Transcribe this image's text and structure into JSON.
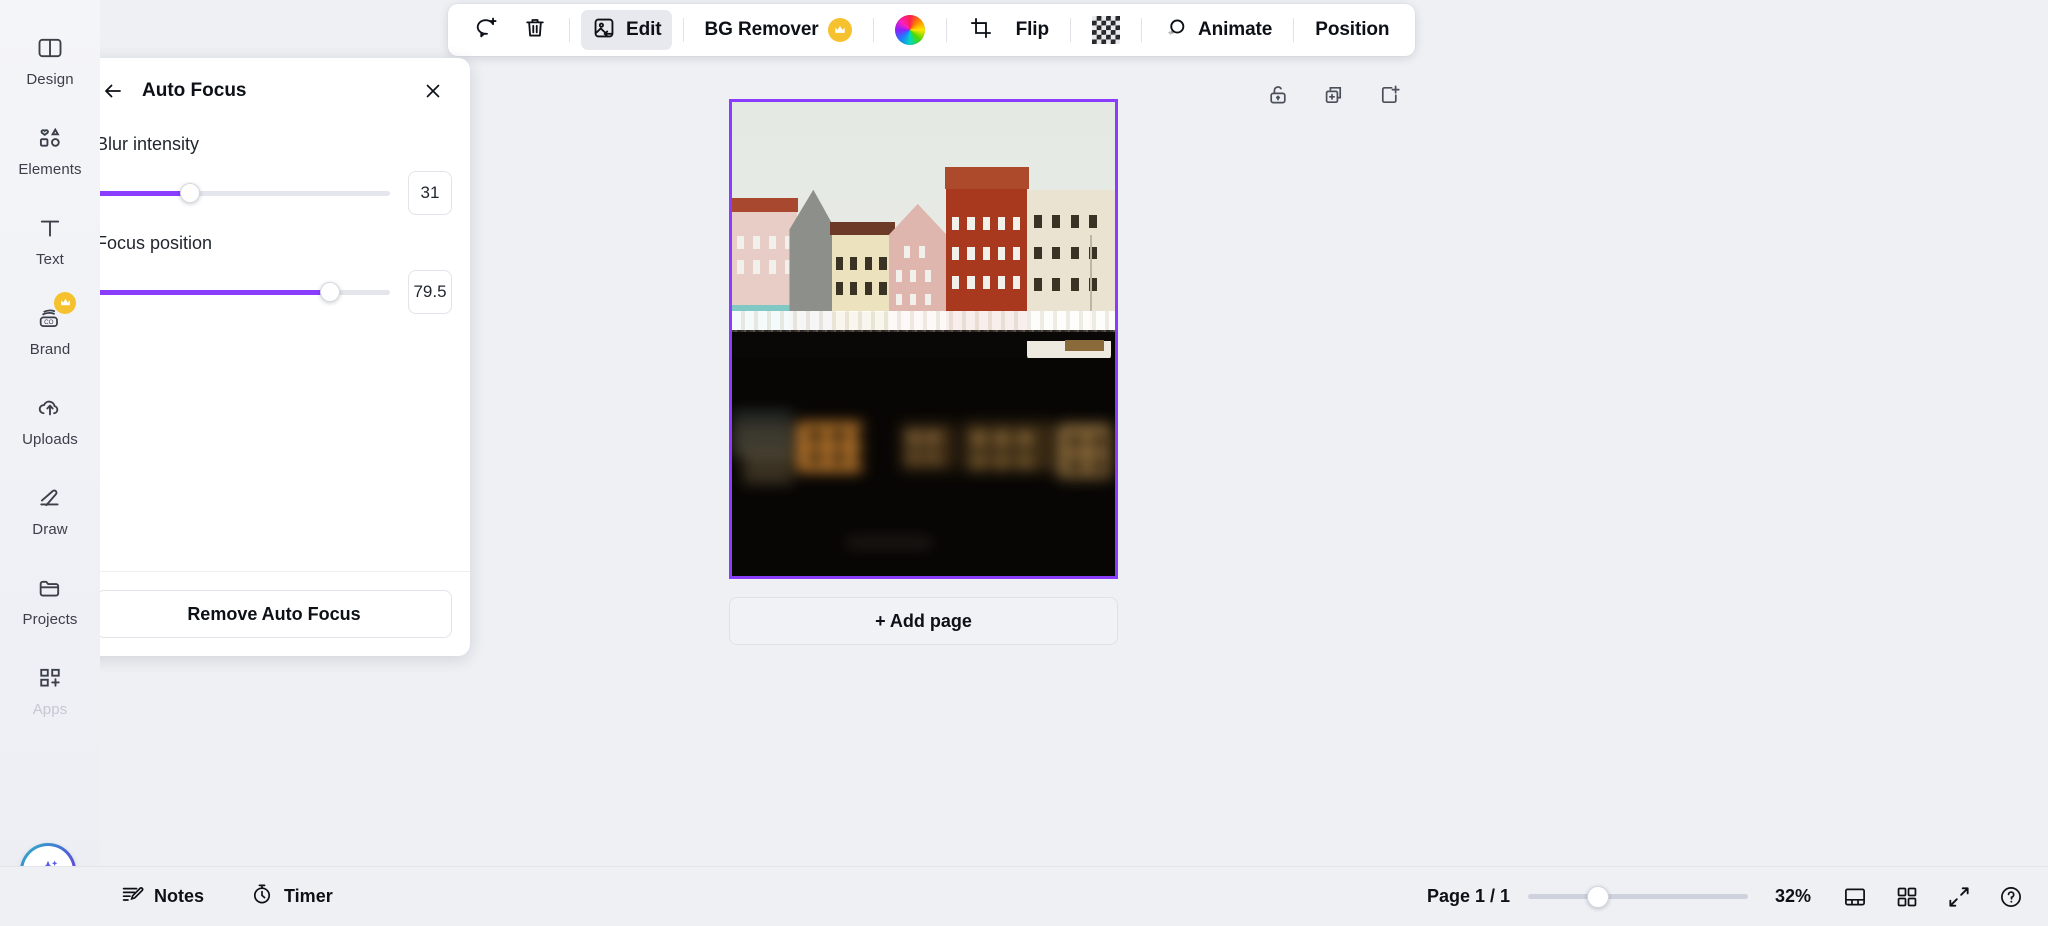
{
  "sidebar": {
    "items": [
      {
        "label": "Design",
        "icon": "design-icon"
      },
      {
        "label": "Elements",
        "icon": "elements-icon"
      },
      {
        "label": "Text",
        "icon": "text-icon"
      },
      {
        "label": "Brand",
        "icon": "brand-icon",
        "badge": "crown-icon"
      },
      {
        "label": "Uploads",
        "icon": "uploads-icon"
      },
      {
        "label": "Draw",
        "icon": "draw-icon"
      },
      {
        "label": "Projects",
        "icon": "projects-icon"
      },
      {
        "label": "Apps",
        "icon": "apps-icon"
      }
    ],
    "magic_button": "magic-sparkle-icon"
  },
  "toolbar": {
    "comment_icon": "add-comment-icon",
    "delete_icon": "trash-icon",
    "edit_label": "Edit",
    "edit_icon": "edit-image-icon",
    "bg_remover_label": "BG Remover",
    "bg_remover_badge": "crown-icon",
    "color_wheel_icon": "color-wheel-icon",
    "crop_icon": "crop-icon",
    "flip_label": "Flip",
    "transparency_icon": "transparency-checkerboard-icon",
    "animate_label": "Animate",
    "animate_icon": "animate-icon",
    "position_label": "Position"
  },
  "panel": {
    "back_icon": "back-arrow-icon",
    "title": "Auto Focus",
    "close_icon": "close-icon",
    "controls": [
      {
        "label": "Blur intensity",
        "value": "31",
        "fill_pct": 32
      },
      {
        "label": "Focus position",
        "value": "79.5",
        "fill_pct": 79.5
      }
    ],
    "remove_label": "Remove Auto Focus"
  },
  "canvas": {
    "page_tools": [
      {
        "icon": "lock-icon"
      },
      {
        "icon": "duplicate-page-icon"
      },
      {
        "icon": "add-page-icon"
      }
    ],
    "selection_color": "#8b3dff",
    "add_page_label": "+ Add page"
  },
  "bottom": {
    "notes_label": "Notes",
    "notes_icon": "notes-icon",
    "timer_label": "Timer",
    "timer_icon": "timer-icon",
    "page_count": "Page 1 / 1",
    "zoom_pct": "32%",
    "zoom_fill_pct": 32,
    "icons": [
      {
        "icon": "notes-view-icon"
      },
      {
        "icon": "grid-view-icon"
      },
      {
        "icon": "fullscreen-icon"
      },
      {
        "icon": "help-icon"
      }
    ]
  }
}
